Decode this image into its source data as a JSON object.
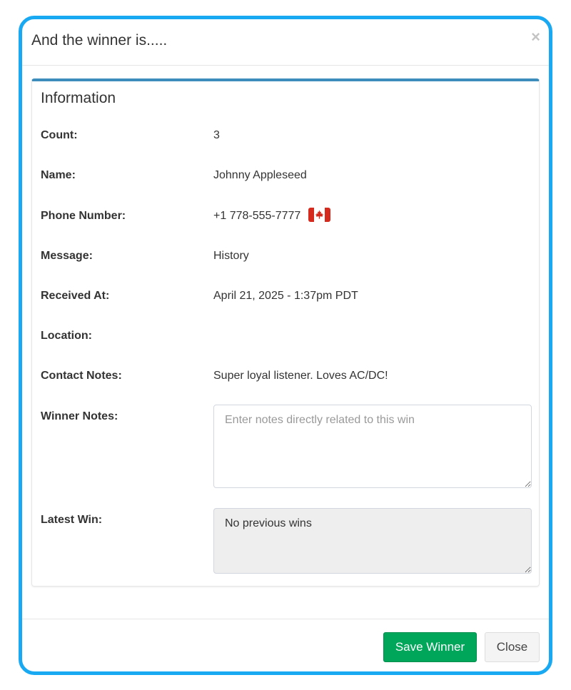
{
  "modal": {
    "title": "And the winner is.....",
    "close_symbol": "×"
  },
  "panel": {
    "title": "Information",
    "fields": {
      "count": {
        "label": "Count:",
        "value": "3"
      },
      "name": {
        "label": "Name:",
        "value": "Johnny Appleseed"
      },
      "phone": {
        "label": "Phone Number:",
        "value": "+1 778-555-7777",
        "flag_icon": "canada-flag-icon"
      },
      "message": {
        "label": "Message:",
        "value": "History"
      },
      "received_at": {
        "label": "Received At:",
        "value": "April 21, 2025 - 1:37pm PDT"
      },
      "location": {
        "label": "Location:",
        "value": ""
      },
      "contact_notes": {
        "label": "Contact Notes:",
        "value": "Super loyal listener. Loves AC/DC!"
      },
      "winner_notes": {
        "label": "Winner Notes:",
        "value": "",
        "placeholder": "Enter notes directly related to this win"
      },
      "latest_win": {
        "label": "Latest Win:",
        "value": "No previous wins"
      }
    }
  },
  "footer": {
    "save_label": "Save Winner",
    "close_label": "Close"
  },
  "colors": {
    "frame_border": "#19a9f2",
    "panel_accent": "#3c8dbc",
    "save_button": "#00a65a",
    "close_button": "#f4f4f4"
  }
}
